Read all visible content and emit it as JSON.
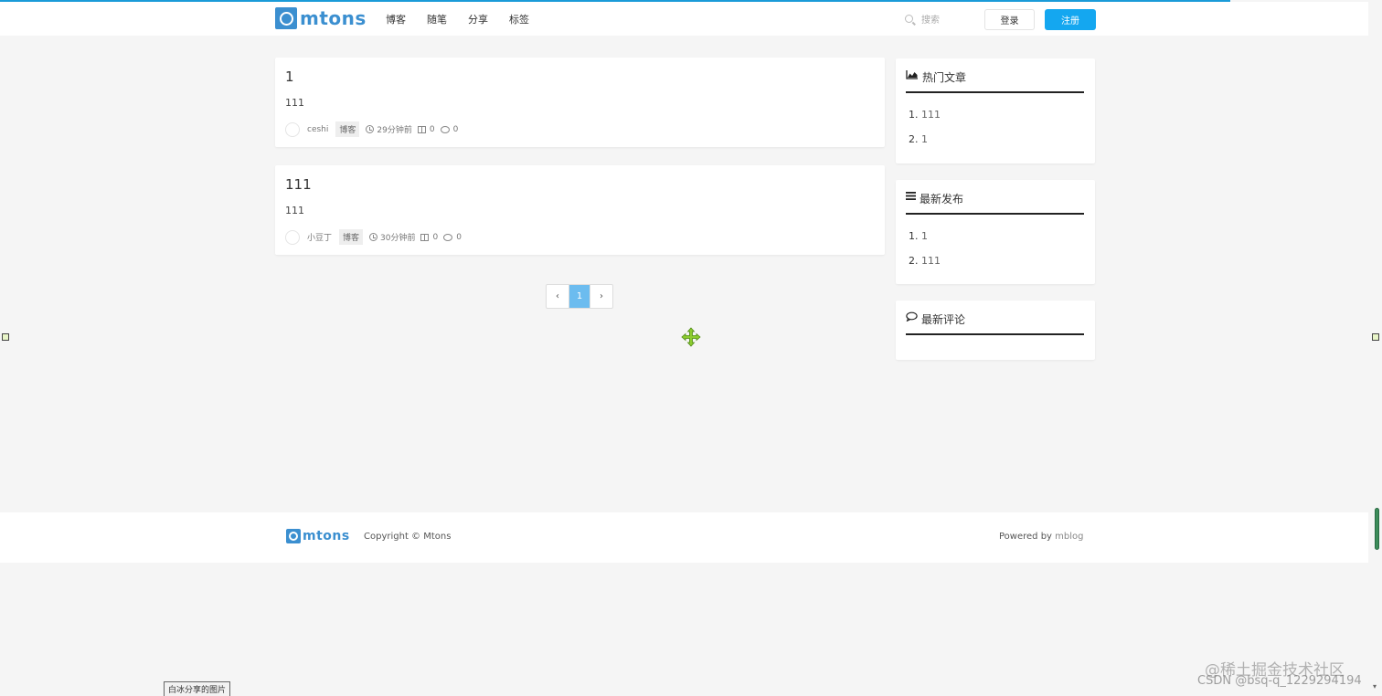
{
  "brand": {
    "name": "mtons",
    "color": "#3b8fd0"
  },
  "nav": {
    "items": [
      "博客",
      "随笔",
      "分享",
      "标签"
    ]
  },
  "search": {
    "placeholder": "搜索"
  },
  "auth": {
    "login": "登录",
    "register": "注册"
  },
  "posts": [
    {
      "title": "1",
      "summary": "111",
      "author": "ceshi",
      "tag": "博客",
      "time": "29分钟前",
      "views": "0",
      "comments": "0"
    },
    {
      "title": "111",
      "summary": "111",
      "author": "小豆丁",
      "tag": "博客",
      "time": "30分钟前",
      "views": "0",
      "comments": "0"
    }
  ],
  "pagination": {
    "prev": "‹",
    "current": "1",
    "next": "›"
  },
  "widgets": {
    "hot": {
      "title": "热门文章",
      "icon": "area-chart-icon",
      "items": [
        "111",
        "1"
      ]
    },
    "latest": {
      "title": "最新发布",
      "icon": "list-icon",
      "items": [
        "1",
        "111"
      ]
    },
    "comments": {
      "title": "最新评论",
      "icon": "comment-icon",
      "items": []
    }
  },
  "footer": {
    "copyright": "Copyright © Mtons",
    "powered_prefix": "Powered by ",
    "powered_link": "mblog"
  },
  "overlay": {
    "caption": "白冰分享的图片",
    "watermark1": "@稀土掘金技术社区",
    "watermark2": "CSDN @bsq-q_1229294194"
  },
  "colors": {
    "accent": "#14a7f0",
    "topline": "#1a9bd8",
    "page_active": "#6cbcef"
  }
}
